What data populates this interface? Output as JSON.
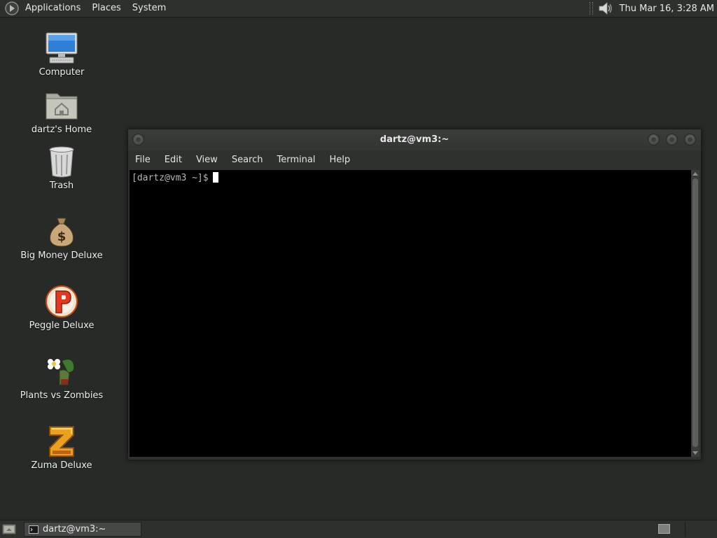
{
  "top_panel": {
    "menus": [
      "Applications",
      "Places",
      "System"
    ],
    "clock": "Thu Mar 16,  3:28 AM",
    "icons": {
      "logo": "gnome-foot-icon",
      "volume": "speaker-icon"
    }
  },
  "desktop": {
    "icons": [
      {
        "label": "Computer",
        "icon": "computer-icon"
      },
      {
        "label": "dartz's Home",
        "icon": "home-folder-icon"
      },
      {
        "label": "Trash",
        "icon": "trash-icon"
      },
      {
        "label": "Big Money Deluxe",
        "icon": "money-bag-icon"
      },
      {
        "label": "Peggle Deluxe",
        "icon": "peggle-icon"
      },
      {
        "label": "Plants vs Zombies",
        "icon": "plants-vs-zombies-icon"
      },
      {
        "label": "Zuma Deluxe",
        "icon": "zuma-icon"
      }
    ]
  },
  "terminal": {
    "title": "dartz@vm3:~",
    "menu": [
      "File",
      "Edit",
      "View",
      "Search",
      "Terminal",
      "Help"
    ],
    "prompt": "[dartz@vm3 ~]$"
  },
  "bottom_panel": {
    "task_label": "dartz@vm3:~"
  },
  "colors": {
    "desktop_bg": "#272a27",
    "panel_bg": "#2e302e",
    "terminal_bg": "#000000"
  }
}
